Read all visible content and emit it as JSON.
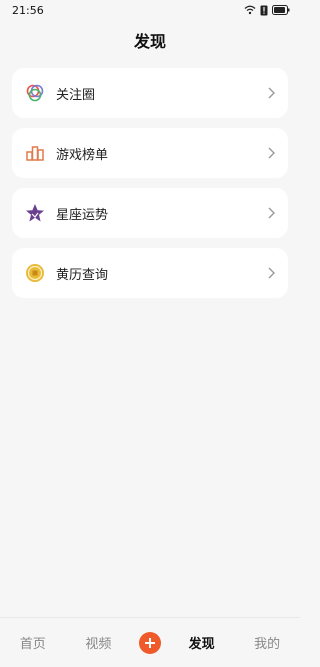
{
  "status": {
    "time": "21:56"
  },
  "header": {
    "title": "发现"
  },
  "items": [
    {
      "label": "关注圈",
      "icon": "circle-rings-icon"
    },
    {
      "label": "游戏榜单",
      "icon": "ranking-blocks-icon"
    },
    {
      "label": "星座运势",
      "icon": "star-badge-icon"
    },
    {
      "label": "黄历查询",
      "icon": "gold-coin-icon"
    }
  ],
  "nav": {
    "home": "首页",
    "video": "视频",
    "discover": "发现",
    "mine": "我的"
  },
  "colors": {
    "accent": "#ee5a29",
    "background": "#f6f6f6"
  }
}
